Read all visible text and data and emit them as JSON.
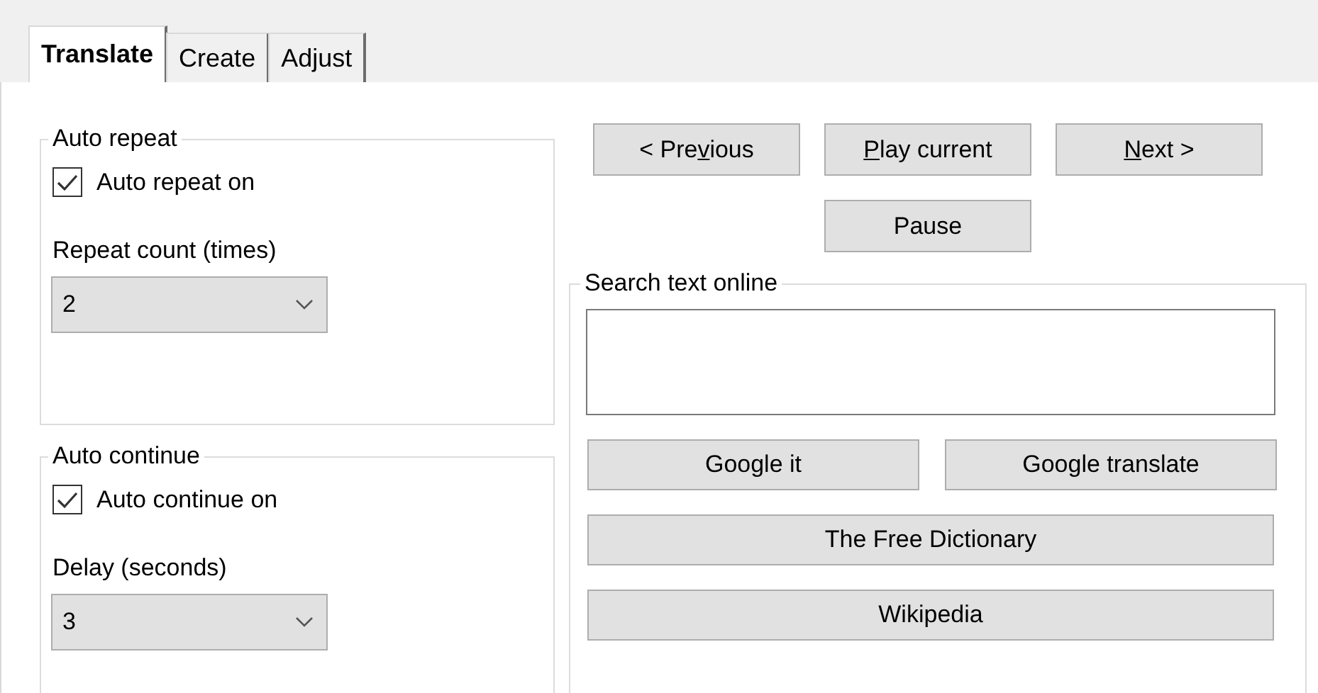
{
  "tabs": [
    {
      "label": "Translate",
      "selected": true
    },
    {
      "label": "Create",
      "selected": false
    },
    {
      "label": "Adjust",
      "selected": false
    }
  ],
  "auto_repeat": {
    "title": "Auto repeat",
    "checkbox": {
      "label": "Auto repeat on",
      "checked": true
    },
    "field_label": "Repeat count (times)",
    "value": "2"
  },
  "auto_continue": {
    "title": "Auto continue",
    "checkbox": {
      "label": "Auto continue on",
      "checked": true
    },
    "field_label": "Delay (seconds)",
    "value": "3"
  },
  "playback_buttons": [
    {
      "label_start": "< Pre",
      "access_key": "v",
      "label_end": "ious"
    },
    {
      "access_key": "P",
      "label_end": "lay current"
    },
    {
      "access_key": "N",
      "label_end": "ext >"
    },
    {
      "label": "Pause"
    }
  ],
  "search_online": {
    "title": "Search text online",
    "buttons": [
      {
        "label": "Google it"
      },
      {
        "label": "Google translate"
      },
      {
        "label": "The Free Dictionary"
      },
      {
        "label": "Wikipedia"
      }
    ]
  }
}
